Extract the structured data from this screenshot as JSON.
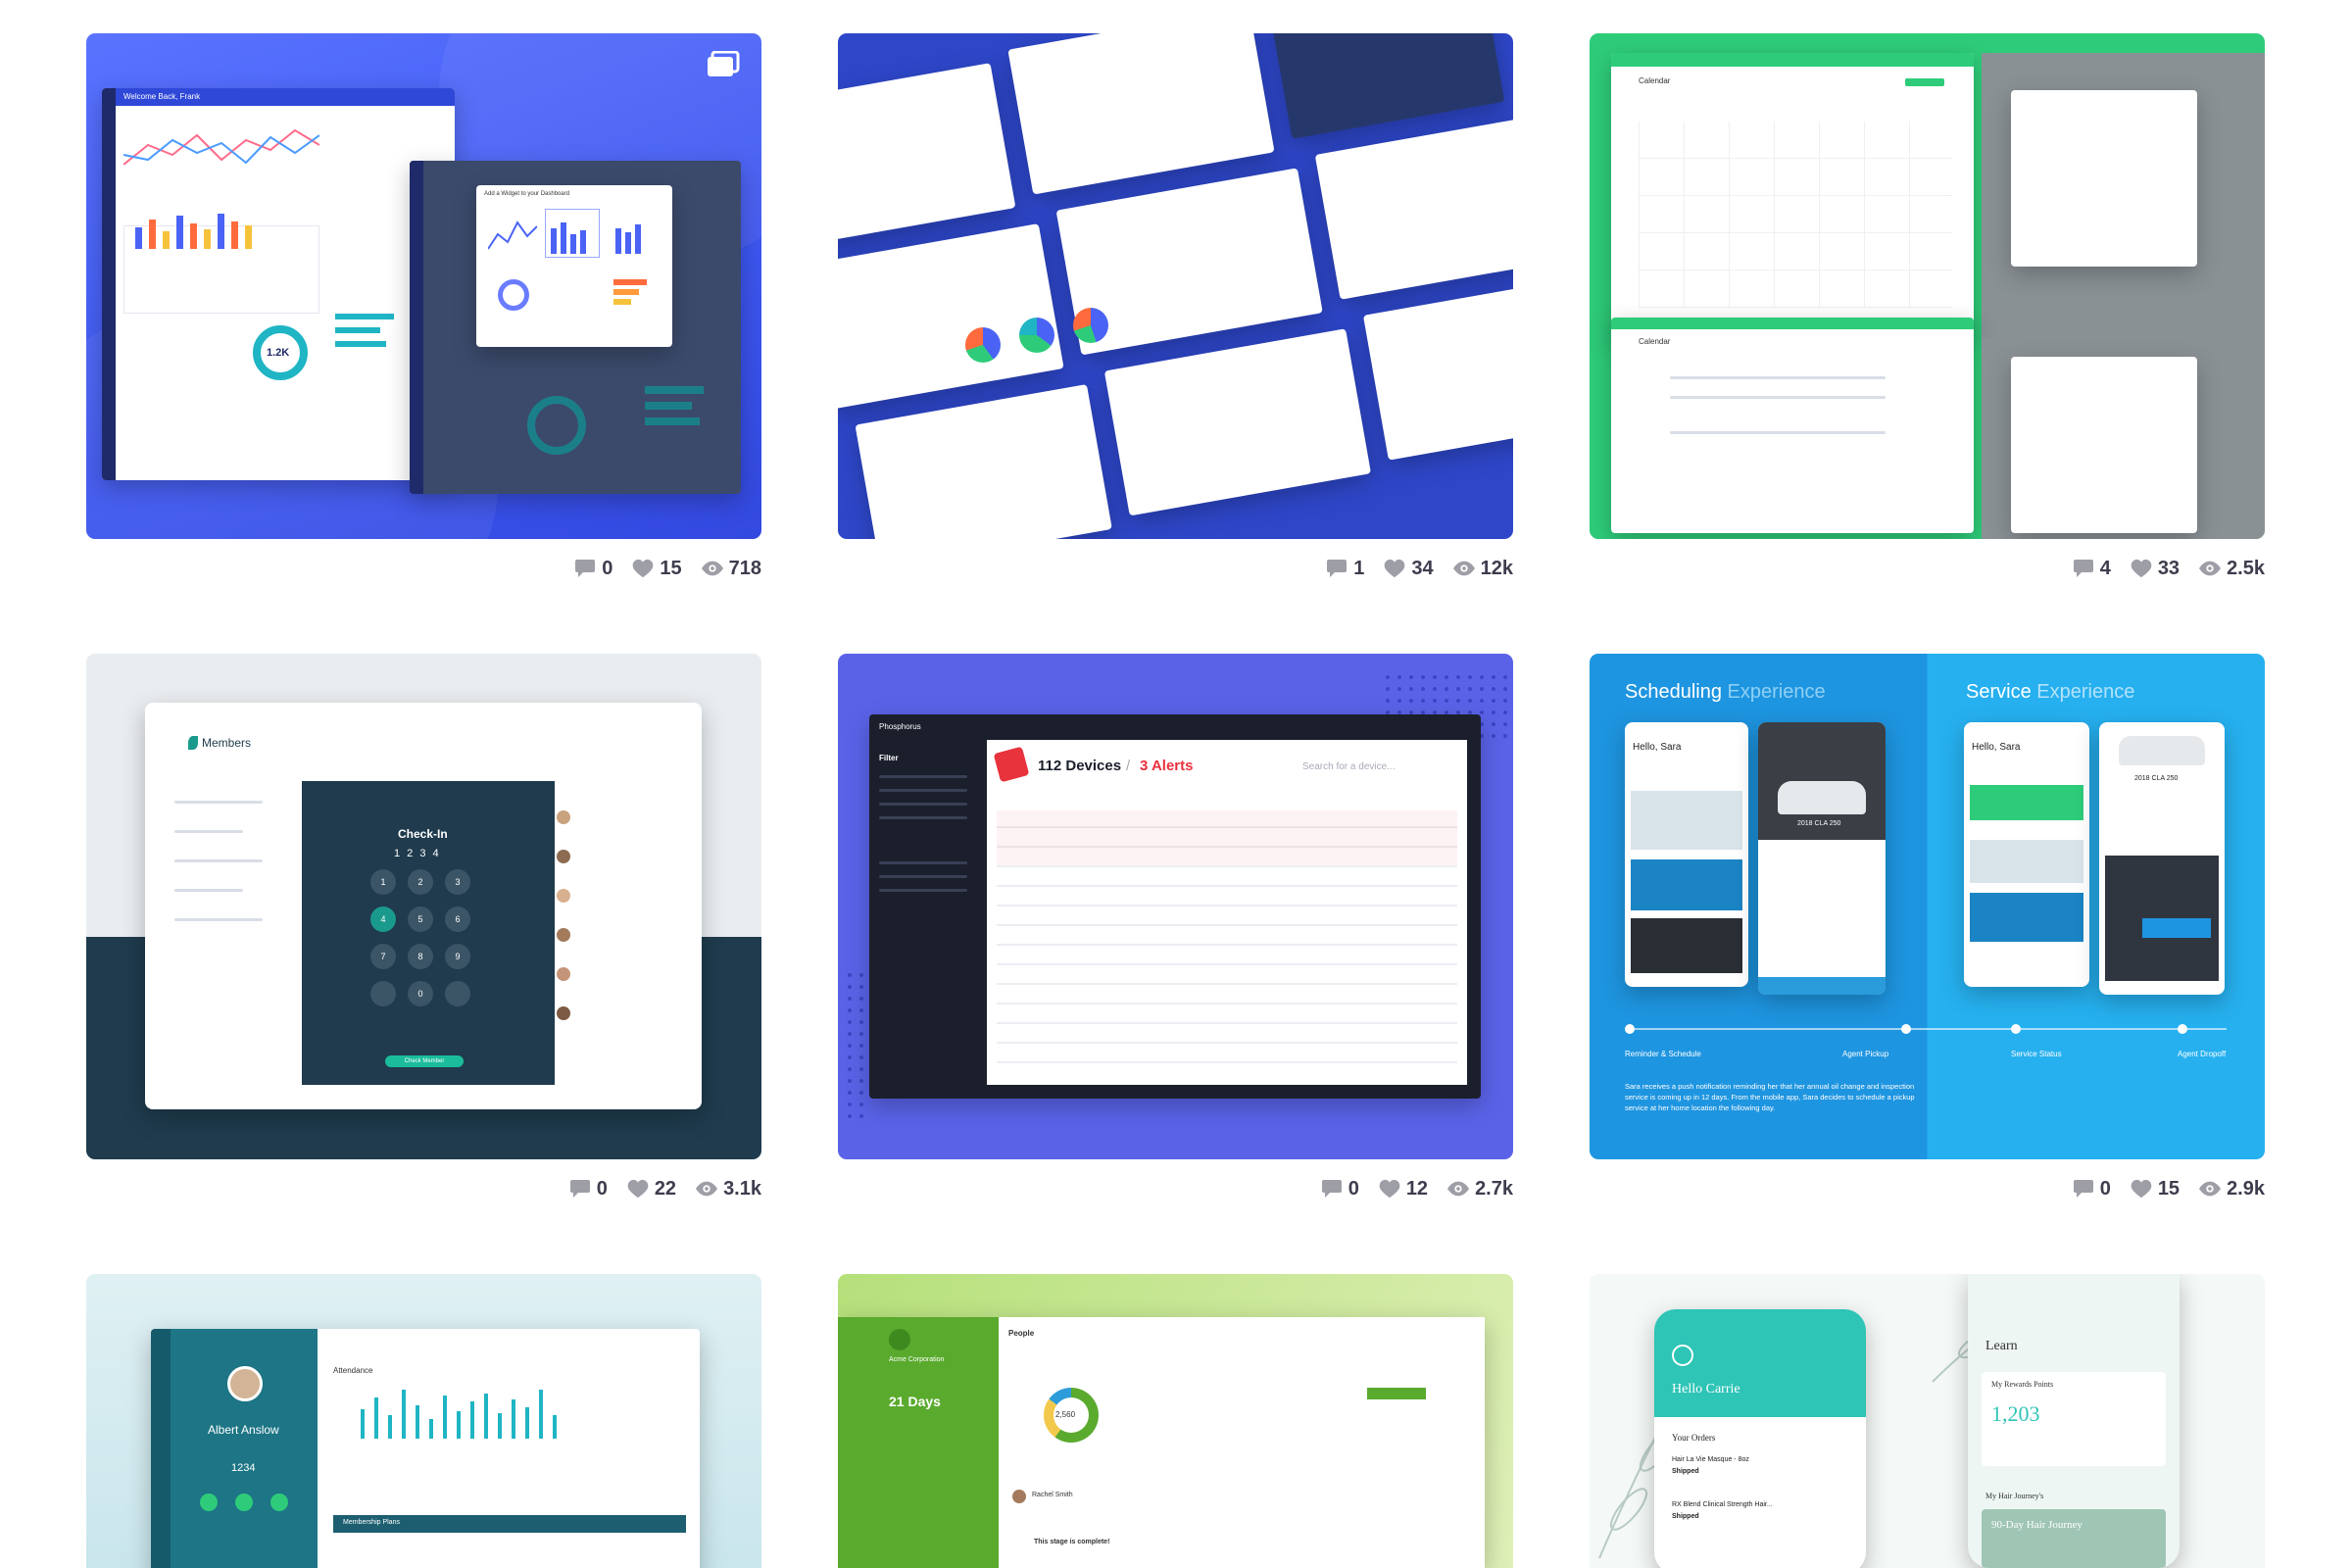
{
  "cards": [
    {
      "stats": {
        "comments": "0",
        "likes": "15",
        "views": "718"
      },
      "mock": {
        "welcome": "Welcome Back, Frank",
        "donut_value": "1.2K",
        "dialog_title": "Add a Widget to your Dashboard"
      }
    },
    {
      "stats": {
        "comments": "1",
        "likes": "34",
        "views": "12k"
      },
      "mock": {}
    },
    {
      "stats": {
        "comments": "4",
        "likes": "33",
        "views": "2.5k"
      },
      "mock": {
        "heading_1": "Calendar",
        "heading_2": "Calendar"
      }
    },
    {
      "stats": {
        "comments": "0",
        "likes": "22",
        "views": "3.1k"
      },
      "mock": {
        "app_title": "Members",
        "checkin_title": "Check-In",
        "code": "1 2 3 4",
        "keys": [
          "1",
          "2",
          "3",
          "4",
          "5",
          "6",
          "7",
          "8",
          "9",
          "",
          "0",
          ""
        ],
        "cta": "Check Member"
      }
    },
    {
      "stats": {
        "comments": "0",
        "likes": "12",
        "views": "2.7k"
      },
      "mock": {
        "brand": "Phosphorus",
        "filter": "Filter",
        "devices": "112 Devices",
        "sep": "/",
        "alerts": "3 Alerts",
        "search": "Search for a device..."
      }
    },
    {
      "stats": {
        "comments": "0",
        "likes": "15",
        "views": "2.9k"
      },
      "mock": {
        "left_title_a": "Scheduling",
        "left_title_b": "Experience",
        "right_title_a": "Service",
        "right_title_b": "Experience",
        "greeting": "Hello, Sara",
        "car": "2018 CLA 250",
        "step_1": "Reminder & Schedule",
        "step_2": "Agent Pickup",
        "step_3": "Service Status",
        "step_4": "Agent Dropoff",
        "paragraph": "Sara receives a push notification reminding her that her annual oil change and inspection service is coming up in 12 days. From the mobile app, Sara decides to schedule a pickup service at her home location the following day."
      }
    },
    {
      "stats": {},
      "mock": {
        "member_name": "Albert Anslow",
        "member_id": "1234",
        "section": "Attendance",
        "plans": "Membership Plans"
      }
    },
    {
      "stats": {},
      "mock": {
        "org": "Acme Corporation",
        "days": "21 Days",
        "title": "People",
        "donut_value": "2,560",
        "stage": "This stage is complete!",
        "user": "Rachel Smith"
      }
    },
    {
      "stats": {},
      "mock": {
        "hello": "Hello Carrie",
        "orders": "Your Orders",
        "learn": "Learn",
        "rewards": "My Rewards Points",
        "points": "1,203",
        "journey_label": "My Hair Journey's",
        "journey": "90-Day Hair Journey",
        "item_1": "Hair La Vie Masque - 8oz",
        "item_2": "RX Blend Clinical Strength Hair...",
        "shipped": "Shipped"
      }
    }
  ],
  "colors": {
    "stat_text": "#3d3d4e",
    "icon": "#9e9ea7",
    "blue": "#4a63f5",
    "green": "#2ecc7a",
    "navy": "#1f3b4d",
    "sky": "#1fa3e8"
  }
}
